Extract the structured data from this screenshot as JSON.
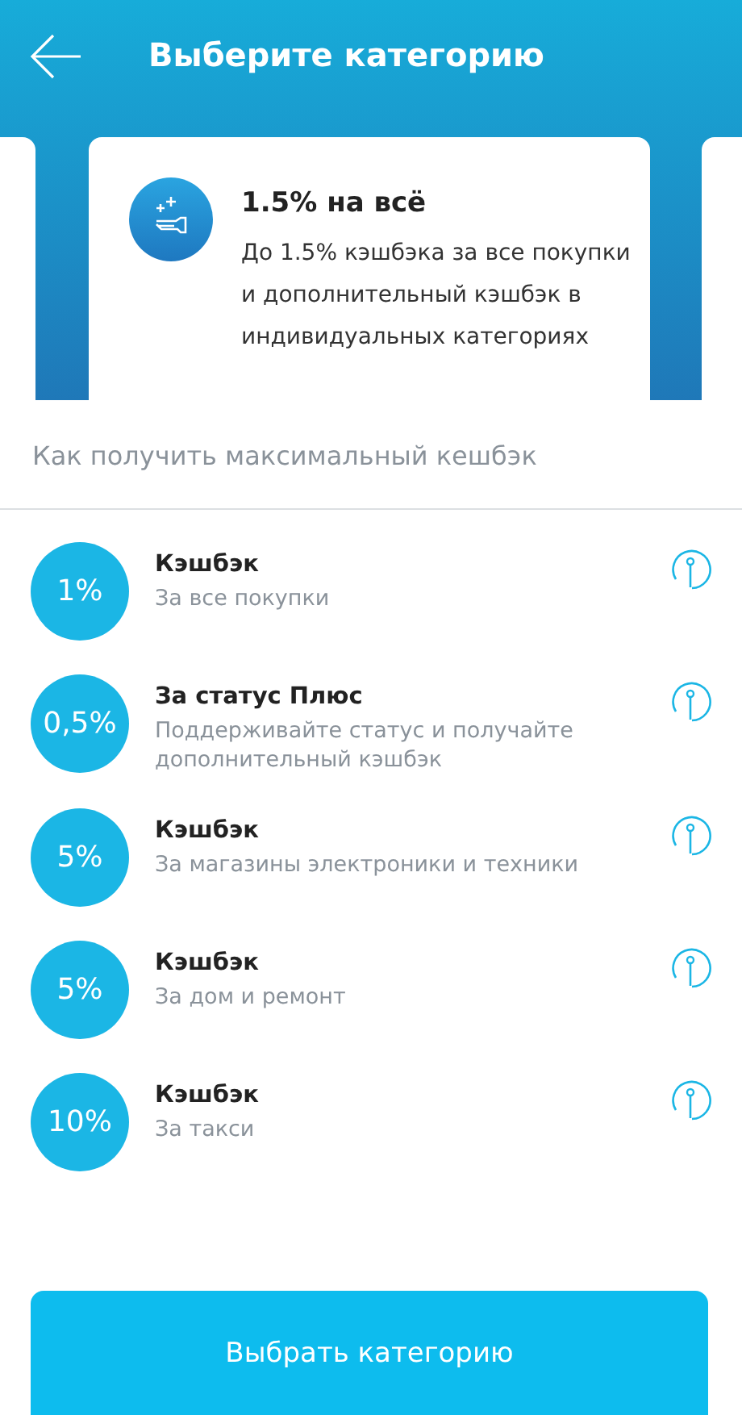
{
  "header": {
    "title": "Выберите категорию"
  },
  "card": {
    "title": "1.5% на всё",
    "description": "До 1.5% кэшбэка за все покупки и дополнительный кэшбэк в индивидуальных категориях"
  },
  "section_title": "Как получить максимальный кешбэк",
  "items": [
    {
      "percent": "1%",
      "title": "Кэшбэк",
      "subtitle": "За все покупки"
    },
    {
      "percent": "0,5%",
      "title": "За статус Плюс",
      "subtitle": "Поддерживайте статус и получайте дополнительный кэшбэк"
    },
    {
      "percent": "5%",
      "title": "Кэшбэк",
      "subtitle": "За магазины электроники и техники"
    },
    {
      "percent": "5%",
      "title": "Кэшбэк",
      "subtitle": "За дом и ремонт"
    },
    {
      "percent": "10%",
      "title": "Кэшбэк",
      "subtitle": "За такси"
    }
  ],
  "button": "Выбрать категорию"
}
